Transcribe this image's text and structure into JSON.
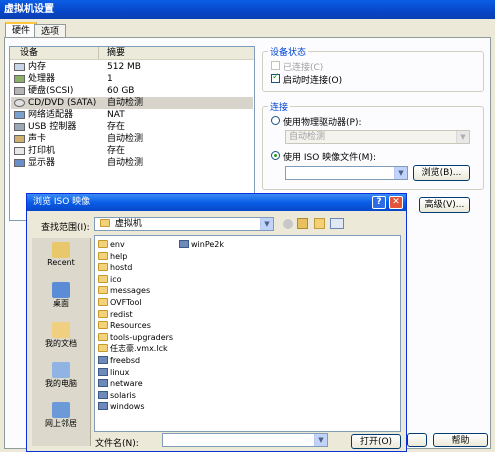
{
  "main": {
    "title": "虚拟机设置",
    "tabs": [
      "硬件",
      "选项"
    ],
    "list_headers": {
      "device": "设备",
      "summary": "摘要"
    },
    "devices": [
      {
        "name": "内存",
        "summary": "512 MB",
        "icon": "memory-icon"
      },
      {
        "name": "处理器",
        "summary": "1",
        "icon": "cpu-icon"
      },
      {
        "name": "硬盘(SCSI)",
        "summary": "60 GB",
        "icon": "harddisk-icon"
      },
      {
        "name": "CD/DVD (SATA)",
        "summary": "自动检测",
        "icon": "cdrom-icon"
      },
      {
        "name": "网络适配器",
        "summary": "NAT",
        "icon": "network-icon"
      },
      {
        "name": "USB 控制器",
        "summary": "存在",
        "icon": "usb-icon"
      },
      {
        "name": "声卡",
        "summary": "自动检测",
        "icon": "sound-icon"
      },
      {
        "name": "打印机",
        "summary": "存在",
        "icon": "printer-icon"
      },
      {
        "name": "显示器",
        "summary": "自动检测",
        "icon": "monitor-icon"
      }
    ],
    "device_status": {
      "group_label": "设备状态",
      "connected": "已连接(C)",
      "connect_on_power": "启动时连接(O)"
    },
    "connection": {
      "group_label": "连接",
      "physical": "使用物理驱动器(P):",
      "physical_value": "自动检测",
      "iso": "使用 ISO 映像文件(M):",
      "iso_value": "",
      "browse": "浏览(B)..."
    },
    "advanced": "高级(V)...",
    "help": "帮助"
  },
  "dialog": {
    "title": "浏览 ISO 映像",
    "look_in_label": "查找范围(I):",
    "look_in_value": "虚拟机",
    "places": [
      "Recent",
      "桌面",
      "我的文档",
      "我的电脑",
      "网上邻居"
    ],
    "files_col1": [
      {
        "name": "env",
        "type": "folder"
      },
      {
        "name": "help",
        "type": "folder"
      },
      {
        "name": "hostd",
        "type": "folder"
      },
      {
        "name": "ico",
        "type": "folder"
      },
      {
        "name": "messages",
        "type": "folder"
      },
      {
        "name": "OVFTool",
        "type": "folder"
      },
      {
        "name": "redist",
        "type": "folder"
      },
      {
        "name": "Resources",
        "type": "folder"
      },
      {
        "name": "tools-upgraders",
        "type": "folder"
      },
      {
        "name": "任志豪.vmx.lck",
        "type": "folder"
      },
      {
        "name": "freebsd",
        "type": "iso"
      },
      {
        "name": "linux",
        "type": "iso"
      },
      {
        "name": "netware",
        "type": "iso"
      },
      {
        "name": "solaris",
        "type": "iso"
      },
      {
        "name": "windows",
        "type": "iso"
      }
    ],
    "files_col2": [
      {
        "name": "winPe2k",
        "type": "iso"
      }
    ],
    "filename_label": "文件名(N):",
    "filename_value": "",
    "open": "打开(O)"
  }
}
